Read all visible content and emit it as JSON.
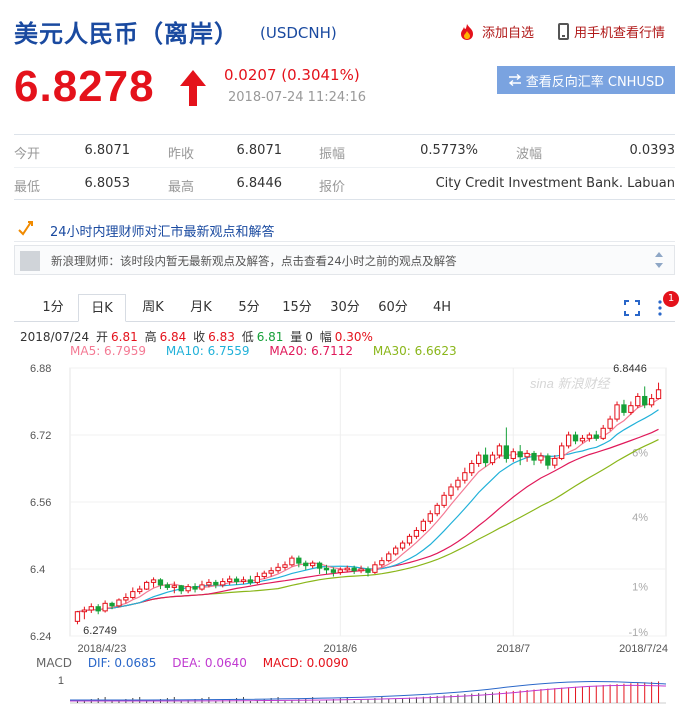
{
  "header": {
    "title": "美元人民币（离岸）",
    "code": "(USDCNH)",
    "add_label": "添加自选",
    "mobile_label": "用手机查看行情"
  },
  "quote": {
    "price": "6.8278",
    "change": "0.0207 (0.3041%)",
    "timestamp": "2018-07-24 11:24:16",
    "reverse_button": "查看反向汇率 CNHUSD",
    "up_color": "#e4121b"
  },
  "stats": {
    "row1": [
      {
        "label": "今开",
        "value": "6.8071"
      },
      {
        "label": "昨收",
        "value": "6.8071"
      },
      {
        "label": "振幅",
        "value": "0.5773%"
      },
      {
        "label": "波幅",
        "value": "0.0393"
      }
    ],
    "row2": [
      {
        "label": "最低",
        "value": "6.8053"
      },
      {
        "label": "最高",
        "value": "6.8446"
      },
      {
        "label": "报价",
        "value": "City Credit Investment Bank. Labuan"
      }
    ]
  },
  "news": {
    "title": "24小时内理财师对汇市最新观点和解答",
    "item": "新浪理财师：该时段内暂无最新观点及解答，点击查看24小时之前的观点及解答"
  },
  "tabs": [
    "1分",
    "日K",
    "周K",
    "月K",
    "5分",
    "15分",
    "30分",
    "60分",
    "4H"
  ],
  "active_tab": "日K",
  "badge": "1",
  "info": {
    "date": "2018/07/24",
    "open_label": "开",
    "open": "6.81",
    "high_label": "高",
    "high": "6.84",
    "close_label": "收",
    "close": "6.83",
    "low_label": "低",
    "low": "6.81",
    "vol_label": "量",
    "vol": "0",
    "amp_label": "幅",
    "amp": "0.30%"
  },
  "ma": {
    "ma5": "MA5: 6.7959",
    "ma10": "MA10: 6.7559",
    "ma20": "MA20: 6.7112",
    "ma30": "MA30: 6.6623"
  },
  "macd": {
    "label": "MACD",
    "dif": "DIF: 0.0685",
    "dea": "DEA: 0.0640",
    "macd": "MACD: 0.0090",
    "axis_top": "1"
  },
  "colors": {
    "up": "#e4121b",
    "down": "#15a038",
    "ma5": "#f47a94",
    "ma10": "#21b1d9",
    "ma20": "#e0195a",
    "ma30": "#8ab61a"
  },
  "chart_data": {
    "type": "candlestick",
    "watermark": "sina 新浪财经",
    "y_ticks": [
      "6.88",
      "6.72",
      "6.56",
      "6.4",
      "6.24"
    ],
    "pct_ticks": [
      "6%",
      "4%",
      "1%",
      "-1%"
    ],
    "x_ticks": [
      "2018/4/23",
      "2018/6",
      "2018/7",
      "2018/7/24"
    ],
    "max_label": "6.8446",
    "min_label": "6.2749",
    "ylim": [
      6.24,
      6.88
    ],
    "candles": [
      [
        6.275,
        6.298,
        6.268,
        6.3
      ],
      [
        6.298,
        6.302,
        6.28,
        6.31
      ],
      [
        6.302,
        6.31,
        6.295,
        6.318
      ],
      [
        6.31,
        6.3,
        6.292,
        6.316
      ],
      [
        6.3,
        6.318,
        6.296,
        6.325
      ],
      [
        6.318,
        6.312,
        6.304,
        6.322
      ],
      [
        6.312,
        6.326,
        6.308,
        6.33
      ],
      [
        6.326,
        6.332,
        6.318,
        6.342
      ],
      [
        6.332,
        6.346,
        6.328,
        6.356
      ],
      [
        6.346,
        6.352,
        6.34,
        6.36
      ],
      [
        6.352,
        6.368,
        6.35,
        6.372
      ],
      [
        6.368,
        6.374,
        6.356,
        6.38
      ],
      [
        6.374,
        6.362,
        6.352,
        6.378
      ],
      [
        6.362,
        6.356,
        6.35,
        6.368
      ],
      [
        6.356,
        6.36,
        6.342,
        6.37
      ],
      [
        6.36,
        6.348,
        6.34,
        6.362
      ],
      [
        6.348,
        6.358,
        6.342,
        6.364
      ],
      [
        6.358,
        6.352,
        6.344,
        6.366
      ],
      [
        6.352,
        6.362,
        6.348,
        6.372
      ],
      [
        6.362,
        6.368,
        6.356,
        6.376
      ],
      [
        6.368,
        6.362,
        6.354,
        6.374
      ],
      [
        6.362,
        6.37,
        6.356,
        6.378
      ],
      [
        6.37,
        6.376,
        6.362,
        6.384
      ],
      [
        6.376,
        6.37,
        6.362,
        6.382
      ],
      [
        6.37,
        6.374,
        6.364,
        6.382
      ],
      [
        6.374,
        6.368,
        6.362,
        6.384
      ],
      [
        6.368,
        6.382,
        6.364,
        6.392
      ],
      [
        6.382,
        6.39,
        6.376,
        6.396
      ],
      [
        6.39,
        6.396,
        6.382,
        6.404
      ],
      [
        6.396,
        6.404,
        6.39,
        6.414
      ],
      [
        6.404,
        6.41,
        6.398,
        6.418
      ],
      [
        6.41,
        6.426,
        6.406,
        6.432
      ],
      [
        6.426,
        6.414,
        6.404,
        6.432
      ],
      [
        6.414,
        6.408,
        6.398,
        6.42
      ],
      [
        6.408,
        6.414,
        6.402,
        6.42
      ],
      [
        6.414,
        6.402,
        6.388,
        6.418
      ],
      [
        6.402,
        6.398,
        6.388,
        6.41
      ],
      [
        6.398,
        6.392,
        6.382,
        6.404
      ],
      [
        6.392,
        6.398,
        6.386,
        6.404
      ],
      [
        6.398,
        6.402,
        6.392,
        6.408
      ],
      [
        6.402,
        6.396,
        6.388,
        6.408
      ],
      [
        6.396,
        6.4,
        6.39,
        6.408
      ],
      [
        6.4,
        6.392,
        6.382,
        6.406
      ],
      [
        6.392,
        6.41,
        6.388,
        6.418
      ],
      [
        6.41,
        6.42,
        6.404,
        6.428
      ],
      [
        6.42,
        6.436,
        6.416,
        6.442
      ],
      [
        6.436,
        6.45,
        6.432,
        6.456
      ],
      [
        6.45,
        6.462,
        6.444,
        6.468
      ],
      [
        6.462,
        6.478,
        6.456,
        6.484
      ],
      [
        6.478,
        6.492,
        6.472,
        6.5
      ],
      [
        6.492,
        6.514,
        6.488,
        6.52
      ],
      [
        6.514,
        6.532,
        6.508,
        6.54
      ],
      [
        6.532,
        6.552,
        6.526,
        6.558
      ],
      [
        6.552,
        6.576,
        6.546,
        6.584
      ],
      [
        6.576,
        6.596,
        6.566,
        6.604
      ],
      [
        6.596,
        6.612,
        6.588,
        6.62
      ],
      [
        6.612,
        6.63,
        6.604,
        6.642
      ],
      [
        6.63,
        6.652,
        6.622,
        6.66
      ],
      [
        6.652,
        6.672,
        6.644,
        6.68
      ],
      [
        6.672,
        6.654,
        6.644,
        6.69
      ],
      [
        6.654,
        6.672,
        6.648,
        6.68
      ],
      [
        6.672,
        6.694,
        6.664,
        6.7
      ],
      [
        6.694,
        6.664,
        6.654,
        6.738
      ],
      [
        6.664,
        6.68,
        6.656,
        6.688
      ],
      [
        6.68,
        6.668,
        6.648,
        6.696
      ],
      [
        6.668,
        6.676,
        6.656,
        6.684
      ],
      [
        6.676,
        6.66,
        6.648,
        6.682
      ],
      [
        6.66,
        6.67,
        6.652,
        6.678
      ],
      [
        6.67,
        6.648,
        6.638,
        6.676
      ],
      [
        6.648,
        6.664,
        6.64,
        6.672
      ],
      [
        6.664,
        6.694,
        6.66,
        6.702
      ],
      [
        6.694,
        6.72,
        6.688,
        6.728
      ],
      [
        6.72,
        6.706,
        6.698,
        6.728
      ],
      [
        6.706,
        6.712,
        6.7,
        6.72
      ],
      [
        6.712,
        6.72,
        6.704,
        6.726
      ],
      [
        6.72,
        6.712,
        6.706,
        6.73
      ],
      [
        6.712,
        6.736,
        6.708,
        6.744
      ],
      [
        6.736,
        6.758,
        6.73,
        6.766
      ],
      [
        6.758,
        6.792,
        6.752,
        6.8
      ],
      [
        6.792,
        6.774,
        6.766,
        6.804
      ],
      [
        6.774,
        6.79,
        6.768,
        6.8
      ],
      [
        6.79,
        6.812,
        6.784,
        6.82
      ],
      [
        6.812,
        6.792,
        6.784,
        6.836
      ],
      [
        6.792,
        6.807,
        6.786,
        6.818
      ],
      [
        6.807,
        6.828,
        6.805,
        6.845
      ]
    ]
  }
}
